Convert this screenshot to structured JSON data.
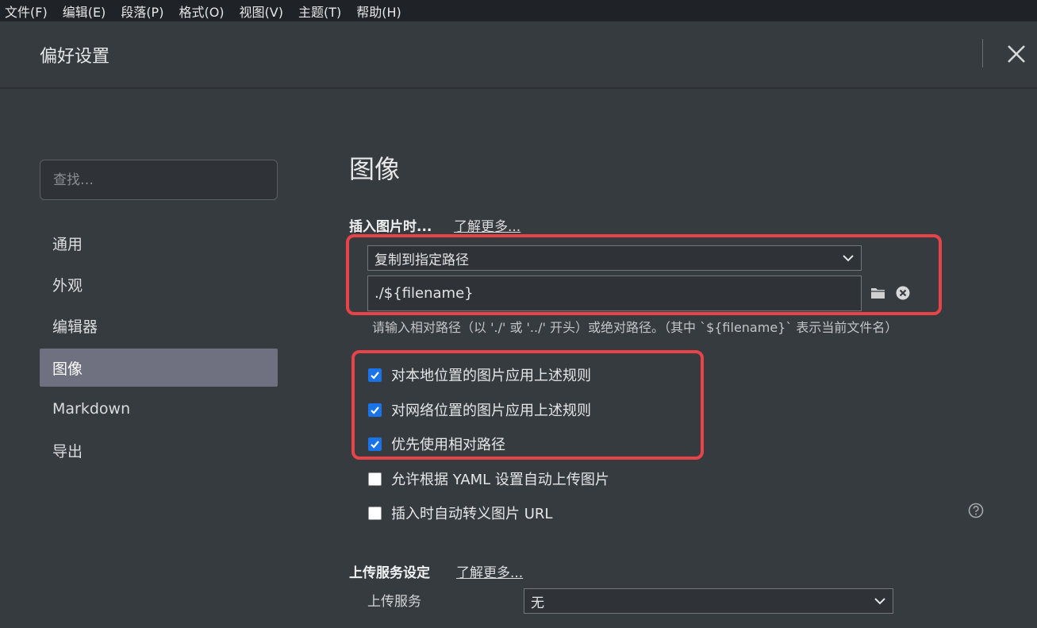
{
  "menubar": [
    "文件(F)",
    "编辑(E)",
    "段落(P)",
    "格式(O)",
    "视图(V)",
    "主题(T)",
    "帮助(H)"
  ],
  "header": {
    "title": "偏好设置",
    "close_icon": "close-icon"
  },
  "search": {
    "placeholder": "查找…",
    "value": ""
  },
  "sidebar": {
    "items": [
      {
        "label": "通用"
      },
      {
        "label": "外观"
      },
      {
        "label": "编辑器"
      },
      {
        "label": "图像",
        "active": true
      },
      {
        "label": "Markdown"
      },
      {
        "label": "导出"
      }
    ]
  },
  "main": {
    "title": "图像",
    "insert": {
      "label": "插入图片时...",
      "learn_more": "了解更多...",
      "action_select": "复制到指定路径",
      "path_value": "./${filename}",
      "hint": "请输入相对路径（以 './' 或 '../' 开头）或绝对路径。（其中 `${filename}` 表示当前文件名）"
    },
    "options": [
      {
        "label": "对本地位置的图片应用上述规则",
        "checked": true
      },
      {
        "label": "对网络位置的图片应用上述规则",
        "checked": true
      },
      {
        "label": "优先使用相对路径",
        "checked": true
      },
      {
        "label": "允许根据 YAML 设置自动上传图片",
        "checked": false
      },
      {
        "label": "插入时自动转义图片 URL",
        "checked": false
      }
    ],
    "upload": {
      "label": "上传服务设定",
      "learn_more": "了解更多...",
      "service_label": "上传服务",
      "service_value": "无"
    }
  },
  "colors": {
    "background": "#363b40",
    "menubar": "#1f2226",
    "active_nav": "#6f7180",
    "highlight_box": "#e9434a",
    "checkbox_on": "#1a73e8"
  }
}
